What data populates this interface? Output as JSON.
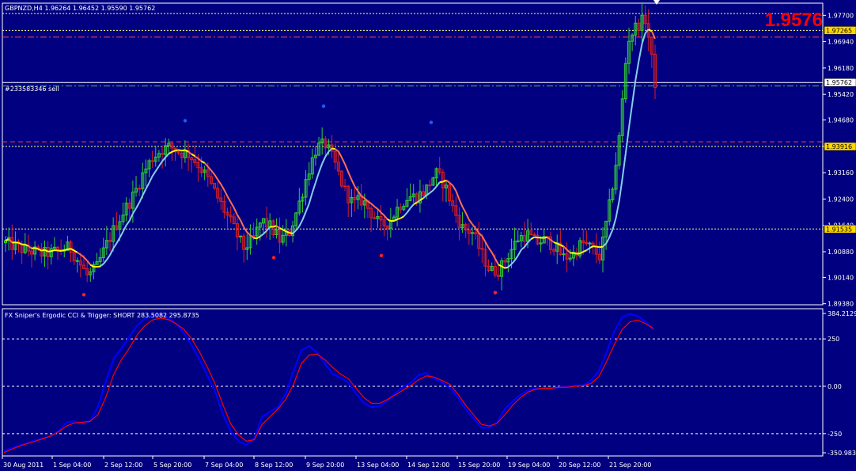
{
  "symbol_header": "GBPNZD,H4  1.96264 1.96452 1.95590 1.95762",
  "big_price": "1.9576",
  "order_label": "#233583346 sell",
  "colors": {
    "background": "#000080",
    "grid": "#ffffff",
    "bull_candle": "#32cd32",
    "bear_candle": "#dc1e1e",
    "ma_up": "#87ceeb",
    "ma_flat": "#ffff00",
    "ma_down": "#ff7050",
    "big_price": "#ff0000",
    "hline_yellow": "#ffff80",
    "hline_red": "#ff4040",
    "hline_green": "#40c040",
    "badge_yellow": "#ffd700",
    "cci_series": "#0000ff",
    "trigger_series": "#ff0000"
  },
  "price_axis": {
    "labels": [
      "1.97700",
      "1.96940",
      "1.96180",
      "1.95420",
      "1.94680",
      "1.93920",
      "1.93160",
      "1.92400",
      "1.91640",
      "1.90880",
      "1.90140",
      "1.89380"
    ],
    "range": [
      1.8935,
      1.9805
    ]
  },
  "price_badges": [
    {
      "label": "1.97265",
      "value": 1.97265,
      "style": "yellow"
    },
    {
      "label": "1.95762",
      "value": 1.95762,
      "style": "white"
    },
    {
      "label": "1.93916",
      "value": 1.93916,
      "style": "yellow"
    },
    {
      "label": "1.91535",
      "value": 1.91535,
      "style": "yellow"
    }
  ],
  "price_lines": [
    {
      "value": 1.9775,
      "color": "yellow",
      "dash": "dotted"
    },
    {
      "value": 1.97265,
      "color": "yellow",
      "dash": "dotted"
    },
    {
      "value": 1.9707,
      "color": "red",
      "dash": "dashdot"
    },
    {
      "value": 1.95762,
      "color": "white",
      "dash": "solid"
    },
    {
      "value": 1.9566,
      "color": "green",
      "dash": "dashdot"
    },
    {
      "value": 1.9405,
      "color": "red",
      "dash": "dashed"
    },
    {
      "value": 1.93916,
      "color": "yellow",
      "dash": "dotted"
    },
    {
      "value": 1.91535,
      "color": "yellow",
      "dash": "dotted"
    }
  ],
  "indicator": {
    "title": "FX Sniper's Ergodic CCI & Trigger: SHORT 283.5082 295.8735",
    "axis_labels": [
      {
        "label": "384.2129",
        "value": 384.2129
      },
      {
        "label": "250",
        "value": 250
      },
      {
        "label": "0.00",
        "value": 0
      },
      {
        "label": "-250",
        "value": -250
      },
      {
        "label": "-350.983",
        "value": -350.983
      }
    ],
    "levels": [
      250,
      0,
      -250
    ],
    "range": [
      -350.983,
      384.2129
    ]
  },
  "time_axis": {
    "labels": [
      "30 Aug 2011",
      "1 Sep 04:00",
      "2 Sep 12:00",
      "5 Sep 20:00",
      "7 Sep 04:00",
      "8 Sep 12:00",
      "9 Sep 20:00",
      "13 Sep 04:00",
      "14 Sep 12:00",
      "15 Sep 20:00",
      "19 Sep 04:00",
      "20 Sep 12:00",
      "21 Sep 20:00"
    ]
  },
  "chart_data": [
    {
      "type": "candlestick",
      "symbol": "GBPNZD",
      "timeframe": "H4",
      "last_bar": {
        "open": 1.96264,
        "high": 1.96452,
        "low": 1.9559,
        "close": 1.95762
      },
      "ylim": [
        1.8935,
        1.9805
      ],
      "x_ticks": [
        "30 Aug 2011",
        "1 Sep 04:00",
        "2 Sep 12:00",
        "5 Sep 20:00",
        "7 Sep 04:00",
        "8 Sep 12:00",
        "9 Sep 20:00",
        "13 Sep 04:00",
        "14 Sep 12:00",
        "15 Sep 20:00",
        "19 Sep 04:00",
        "20 Sep 12:00",
        "21 Sep 20:00"
      ],
      "close_path": [
        1.9114,
        1.9104,
        1.9093,
        1.9089,
        1.9082,
        1.9085,
        1.9093,
        1.9101,
        1.9059,
        1.9016,
        1.9044,
        1.9106,
        1.9162,
        1.9208,
        1.9251,
        1.9311,
        1.9358,
        1.9382,
        1.9391,
        1.9375,
        1.937,
        1.9342,
        1.9302,
        1.9253,
        1.9203,
        1.9153,
        1.9098,
        1.9121,
        1.9178,
        1.9158,
        1.9121,
        1.9142,
        1.9219,
        1.9313,
        1.9389,
        1.9398,
        1.9342,
        1.9268,
        1.9225,
        1.9238,
        1.9199,
        1.9161,
        1.9177,
        1.9221,
        1.9247,
        1.9247,
        1.9269,
        1.9316,
        1.9282,
        1.9206,
        1.9154,
        1.9145,
        1.9084,
        1.9032,
        1.9036,
        1.9082,
        1.9126,
        1.9139,
        1.9114,
        1.9122,
        1.9105,
        1.9071,
        1.9079,
        1.9114,
        1.9099,
        1.9073,
        1.9218,
        1.9392,
        1.9698,
        1.9741,
        1.976,
        1.9576
      ],
      "buy_arrow_prices": [
        1.8964,
        1.9071,
        1.9077,
        1.897
      ],
      "sell_arrow_prices": [
        1.9466,
        1.9508,
        1.9461
      ]
    },
    {
      "type": "line",
      "title": "FX Sniper's Ergodic CCI & Trigger: SHORT 283.5082 295.8735",
      "ylim": [
        -350.983,
        384.2129
      ],
      "y_ticks": [
        384.2129,
        250,
        0,
        -250,
        -350.983
      ],
      "series": [
        {
          "name": "SHORT 283.5082",
          "color": "blue",
          "values": [
            -340,
            -326,
            -312,
            -299,
            -285,
            -275,
            -265,
            -235,
            -190,
            -185,
            -196,
            -184,
            -110,
            24,
            143,
            200,
            260,
            320,
            358,
            376,
            380,
            362,
            330,
            280,
            215,
            140,
            55,
            -30,
            -150,
            -240,
            -290,
            -310,
            -275,
            -160,
            -135,
            -110,
            -40,
            80,
            190,
            212,
            180,
            120,
            65,
            45,
            20,
            -40,
            -90,
            -110,
            -105,
            -75,
            -35,
            -5,
            20,
            60,
            70,
            40,
            20,
            -10,
            -60,
            -120,
            -170,
            -218,
            -220,
            -190,
            -120,
            -80,
            -45,
            -20,
            -10,
            -10,
            -10,
            -5,
            0,
            5,
            5,
            30,
            80,
            180,
            290,
            365,
            382,
            370,
            340,
            300
          ]
        },
        {
          "name": "Trigger 295.8735",
          "color": "red",
          "values": [
            -350,
            -332,
            -315,
            -302,
            -290,
            -276,
            -262,
            -240,
            -210,
            -193,
            -190,
            -185,
            -150,
            -60,
            60,
            140,
            200,
            270,
            320,
            350,
            360,
            352,
            330,
            300,
            250,
            180,
            100,
            10,
            -100,
            -200,
            -258,
            -290,
            -282,
            -200,
            -160,
            -120,
            -70,
            10,
            120,
            165,
            170,
            140,
            100,
            65,
            40,
            -10,
            -60,
            -90,
            -90,
            -70,
            -45,
            -20,
            5,
            35,
            55,
            48,
            30,
            10,
            -40,
            -100,
            -150,
            -200,
            -210,
            -196,
            -150,
            -100,
            -60,
            -30,
            -15,
            -10,
            -10,
            -5,
            -5,
            0,
            3,
            15,
            50,
            130,
            220,
            300,
            340,
            350,
            330,
            305
          ]
        }
      ]
    }
  ]
}
